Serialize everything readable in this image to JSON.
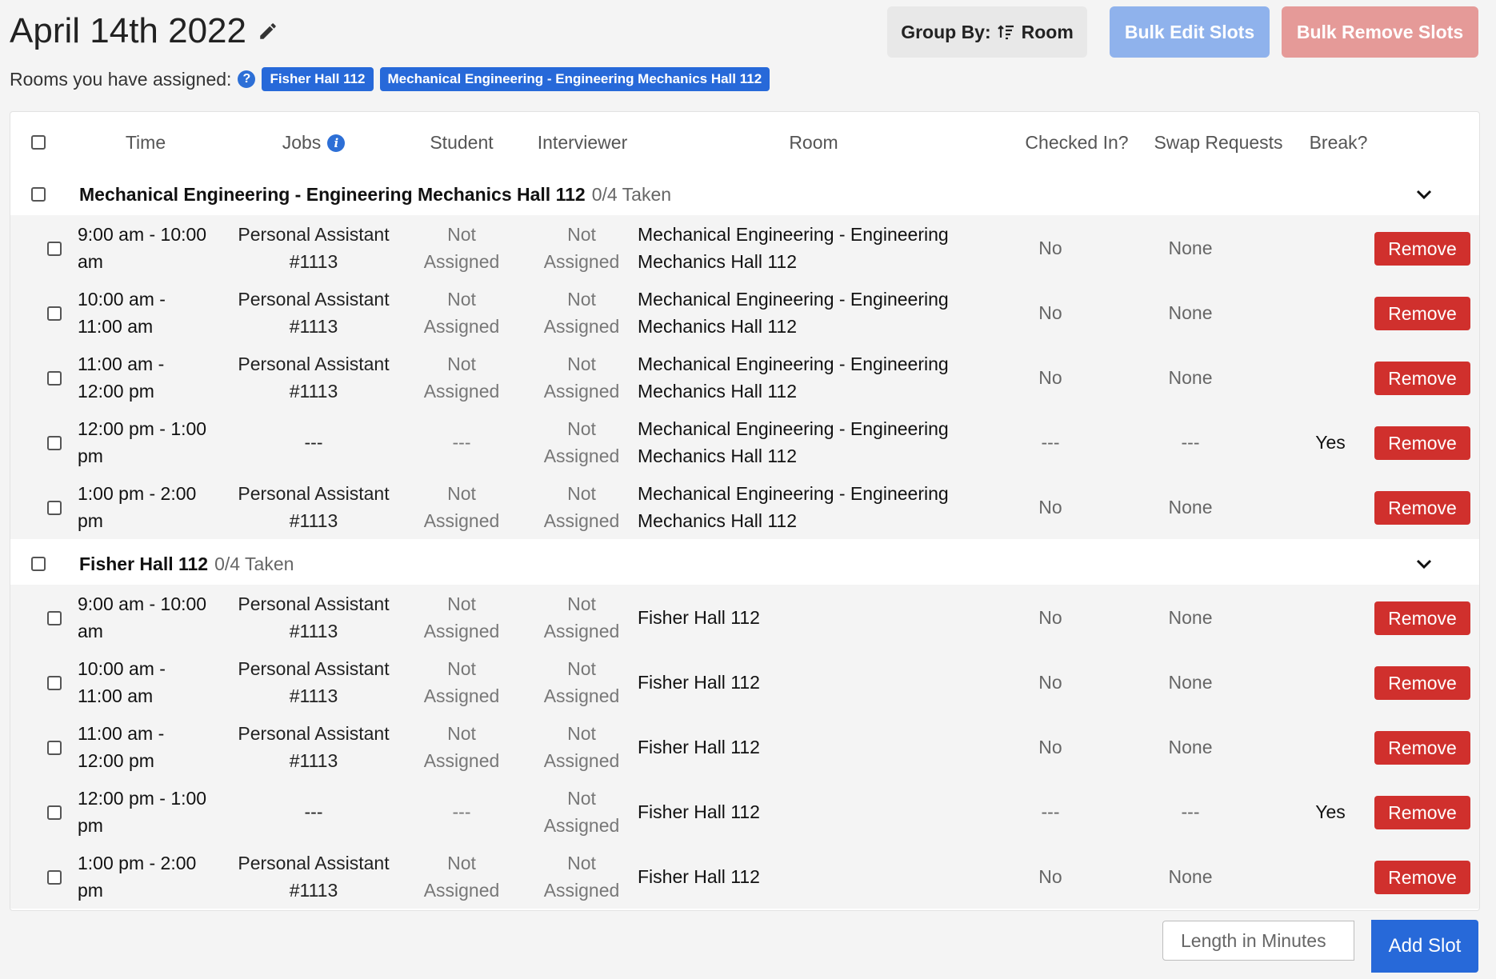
{
  "page": {
    "title": "April 14th 2022",
    "rooms_label": "Rooms you have assigned:",
    "assigned_rooms": [
      "Fisher Hall 112",
      "Mechanical Engineering - Engineering Mechanics Hall 112"
    ]
  },
  "toolbar": {
    "group_by_label": "Group By:",
    "group_by_value": "Room",
    "bulk_edit_label": "Bulk Edit Slots",
    "bulk_remove_label": "Bulk Remove Slots"
  },
  "table": {
    "columns": {
      "time": "Time",
      "jobs": "Jobs",
      "student": "Student",
      "interviewer": "Interviewer",
      "room": "Room",
      "checked_in": "Checked In?",
      "swap_requests": "Swap Requests",
      "break": "Break?"
    },
    "groups": [
      {
        "name": "Mechanical Engineering - Engineering Mechanics Hall 112",
        "count": "0/4 Taken",
        "rows": [
          {
            "time": "9:00 am - 10:00 am",
            "job": "Personal Assistant #1113",
            "student": "Not Assigned",
            "interviewer": "Not Assigned",
            "room": "Mechanical Engineering - Engineering Mechanics Hall 112",
            "checked_in": "No",
            "swap": "None",
            "break": "",
            "action": "Remove"
          },
          {
            "time": "10:00 am - 11:00 am",
            "job": "Personal Assistant #1113",
            "student": "Not Assigned",
            "interviewer": "Not Assigned",
            "room": "Mechanical Engineering - Engineering Mechanics Hall 112",
            "checked_in": "No",
            "swap": "None",
            "break": "",
            "action": "Remove"
          },
          {
            "time": "11:00 am - 12:00 pm",
            "job": "Personal Assistant #1113",
            "student": "Not Assigned",
            "interviewer": "Not Assigned",
            "room": "Mechanical Engineering - Engineering Mechanics Hall 112",
            "checked_in": "No",
            "swap": "None",
            "break": "",
            "action": "Remove"
          },
          {
            "time": "12:00 pm - 1:00 pm",
            "job": "---",
            "student": "---",
            "interviewer": "Not Assigned",
            "room": "Mechanical Engineering - Engineering Mechanics Hall 112",
            "checked_in": "---",
            "swap": "---",
            "break": "Yes",
            "action": "Remove"
          },
          {
            "time": "1:00 pm - 2:00 pm",
            "job": "Personal Assistant #1113",
            "student": "Not Assigned",
            "interviewer": "Not Assigned",
            "room": "Mechanical Engineering - Engineering Mechanics Hall 112",
            "checked_in": "No",
            "swap": "None",
            "break": "",
            "action": "Remove"
          }
        ]
      },
      {
        "name": "Fisher Hall 112",
        "count": "0/4 Taken",
        "rows": [
          {
            "time": "9:00 am - 10:00 am",
            "job": "Personal Assistant #1113",
            "student": "Not Assigned",
            "interviewer": "Not Assigned",
            "room": "Fisher Hall 112",
            "checked_in": "No",
            "swap": "None",
            "break": "",
            "action": "Remove"
          },
          {
            "time": "10:00 am - 11:00 am",
            "job": "Personal Assistant #1113",
            "student": "Not Assigned",
            "interviewer": "Not Assigned",
            "room": "Fisher Hall 112",
            "checked_in": "No",
            "swap": "None",
            "break": "",
            "action": "Remove"
          },
          {
            "time": "11:00 am - 12:00 pm",
            "job": "Personal Assistant #1113",
            "student": "Not Assigned",
            "interviewer": "Not Assigned",
            "room": "Fisher Hall 112",
            "checked_in": "No",
            "swap": "None",
            "break": "",
            "action": "Remove"
          },
          {
            "time": "12:00 pm - 1:00 pm",
            "job": "---",
            "student": "---",
            "interviewer": "Not Assigned",
            "room": "Fisher Hall 112",
            "checked_in": "---",
            "swap": "---",
            "break": "Yes",
            "action": "Remove"
          },
          {
            "time": "1:00 pm - 2:00 pm",
            "job": "Personal Assistant #1113",
            "student": "Not Assigned",
            "interviewer": "Not Assigned",
            "room": "Fisher Hall 112",
            "checked_in": "No",
            "swap": "None",
            "break": "",
            "action": "Remove"
          }
        ]
      }
    ]
  },
  "footer": {
    "length_placeholder": "Length in Minutes",
    "add_slot_label": "Add Slot"
  },
  "colors": {
    "primary": "#2769d9",
    "danger": "#d0302d",
    "primary_disabled": "#8fb2ec",
    "danger_disabled": "#e59a98"
  },
  "icons": [
    "pencil-icon",
    "help-icon",
    "info-icon",
    "sort-icon",
    "chevron-down-icon"
  ]
}
